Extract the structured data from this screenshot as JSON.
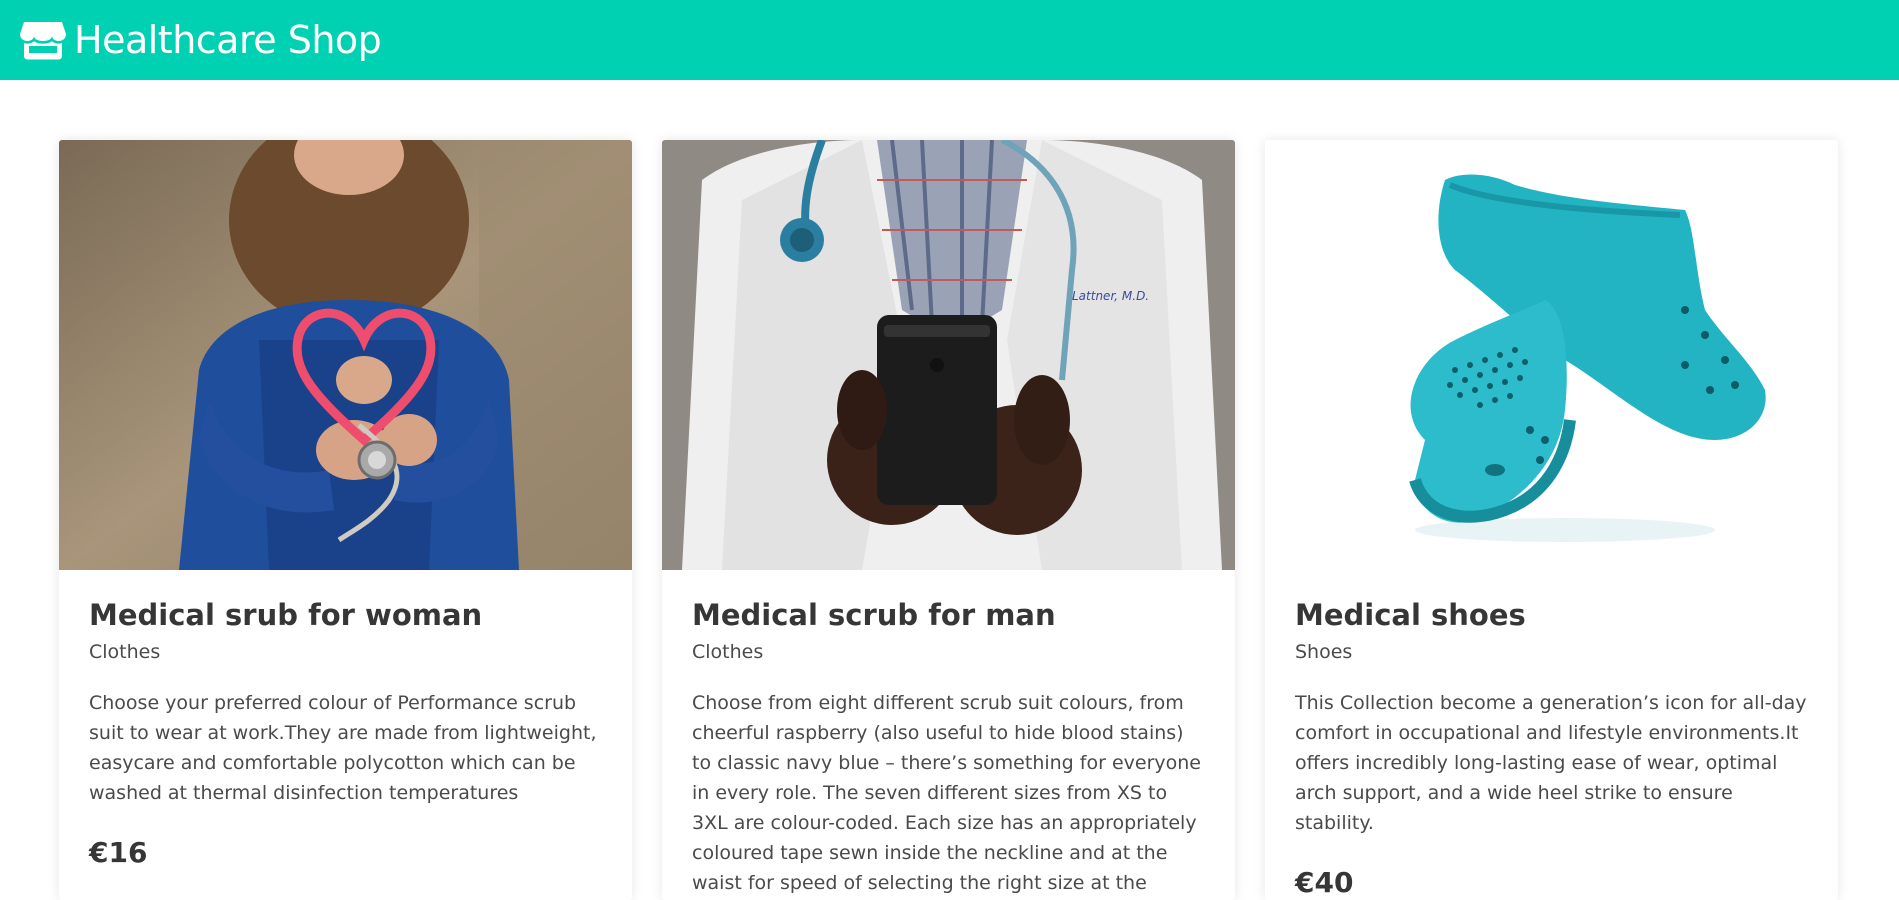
{
  "navbar": {
    "brand_icon": "store-icon",
    "brand_title": "Healthcare Shop",
    "background": "#00d1b2"
  },
  "products": [
    {
      "title": "Medical srub for woman",
      "category": "Clothes",
      "description": "Choose your preferred colour of Performance scrub suit to wear at work.They are made from lightweight, easycare and comfortable polycotton which can be washed at thermal disinfection temperatures",
      "price": "€16",
      "image": "woman-in-blue-scrubs-holding-pink-stethoscope-photo"
    },
    {
      "title": "Medical scrub for man",
      "category": "Clothes",
      "description": "Choose from eight different scrub suit colours, from cheerful raspberry (also useful to hide blood stains) to classic navy blue – there’s something for everyone in every role. The seven different sizes from XS to 3XL are colour-coded. Each size has an appropriately coloured tape sewn inside the neckline and at the waist for speed of selecting the right size at the hospital.",
      "price": "",
      "image": "doctor-in-white-coat-holding-phone-photo"
    },
    {
      "title": "Medical shoes",
      "category": "Shoes",
      "description": "This Collection become a generation’s icon for all-day comfort in occupational and lifestyle environments.It offers incredibly long-lasting ease of wear, optimal arch support, and a wide heel strike to ensure stability.",
      "price": "€40",
      "image": "turquoise-clog-shoes-photo"
    }
  ]
}
